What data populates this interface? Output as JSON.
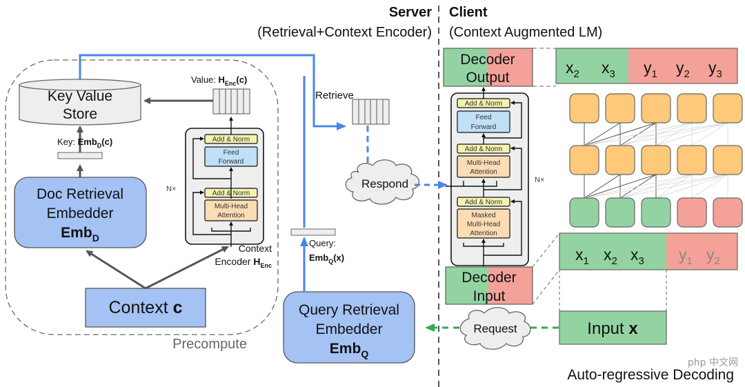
{
  "header": {
    "server_title": "Server",
    "server_subtitle": "(Retrieval+Context Encoder)",
    "client_title": "Client",
    "client_subtitle": "(Context Augmented LM)"
  },
  "server": {
    "kv_store": {
      "line1": "Key Value",
      "line2": "Store"
    },
    "key_label": {
      "prefix": "Key: ",
      "emb": "Emb",
      "sub": "D",
      "suffix": "(c)"
    },
    "value_label": {
      "prefix": "Value: ",
      "h": "H",
      "sub": "Enc",
      "suffix": "(c)"
    },
    "doc_embedder": {
      "line1": "Doc Retrieval",
      "line2": "Embedder",
      "emb": "Emb",
      "sub": "D"
    },
    "context": {
      "text": "Context ",
      "bold": "c"
    },
    "encoder_label": {
      "line1": "Context",
      "line2": "Encoder ",
      "h": "H",
      "sub": "Enc"
    },
    "nx": "N×",
    "precompute": "Precompute",
    "retrieve": "Retrieve",
    "respond": "Respond",
    "query_label": {
      "line1": "Query:",
      "emb": "Emb",
      "sub": "Q",
      "suffix": "(x)"
    },
    "query_embedder": {
      "line1": "Query Retrieval",
      "line2": "Embedder",
      "emb": "Emb",
      "sub": "Q"
    },
    "encoder_block": {
      "add_norm": "Add & Norm",
      "feed_forward": [
        "Feed",
        "Forward"
      ],
      "mha": [
        "Multi-Head",
        "Attention"
      ]
    }
  },
  "client": {
    "decoder_output": [
      "Decoder",
      "Output"
    ],
    "decoder_input": [
      "Decoder",
      "Input"
    ],
    "request": "Request",
    "input_x": {
      "text": "Input ",
      "bold": "x"
    },
    "nx": "N×",
    "decoder_block": {
      "add_norm": "Add & Norm",
      "feed_forward": [
        "Feed",
        "Forward"
      ],
      "mha": [
        "Multi-Head",
        "Attention"
      ],
      "masked_mha": [
        "Masked",
        "Multi-Head",
        "Attention"
      ]
    },
    "output_tokens": [
      {
        "b": "x",
        "s": "2",
        "kind": "x"
      },
      {
        "b": "x",
        "s": "3",
        "kind": "x"
      },
      {
        "b": "y",
        "s": "1",
        "kind": "y"
      },
      {
        "b": "y",
        "s": "2",
        "kind": "y"
      },
      {
        "b": "y",
        "s": "3",
        "kind": "y"
      }
    ],
    "input_tokens": [
      {
        "b": "x",
        "s": "1",
        "kind": "x"
      },
      {
        "b": "x",
        "s": "2",
        "kind": "x"
      },
      {
        "b": "x",
        "s": "3",
        "kind": "x"
      },
      {
        "b": "y",
        "s": "1",
        "kind": "y"
      },
      {
        "b": "y",
        "s": "2",
        "kind": "y"
      }
    ],
    "grid_bottom_kinds": [
      "x",
      "x",
      "x",
      "y",
      "y"
    ],
    "caption": "Auto-regressive Decoding"
  },
  "watermark": "php 中文网",
  "colors": {
    "blue_box": "#a4c2f4",
    "blue_line": "#4a86e8",
    "green": "#93d3a2",
    "red": "#f4a19a",
    "orange": "#ffc97a",
    "ff_blue": "#bfe0f5",
    "attn_orange": "#fcdcb4",
    "norm_yellow": "#f3f2b0",
    "request_green": "#34a853"
  }
}
